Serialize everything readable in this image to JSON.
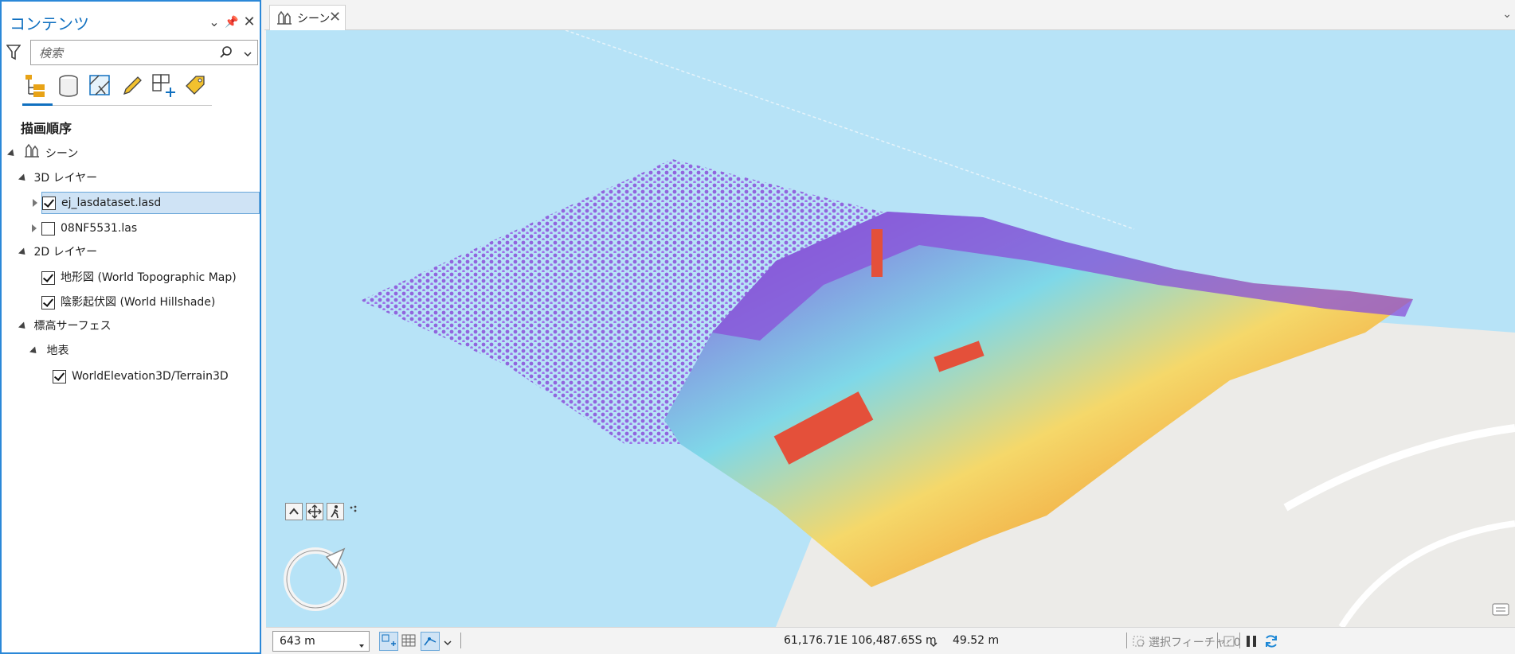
{
  "contents_pane": {
    "title": "コンテンツ",
    "search_placeholder": "検索",
    "toolbar_icons": [
      "drawing-order-icon",
      "data-source-icon",
      "selection-icon",
      "editing-icon",
      "snapping-icon",
      "labeling-icon"
    ],
    "section_title": "描画順序",
    "tree": {
      "scene": "シーン",
      "group_3d": "3D レイヤー",
      "layer_lasd": "ej_lasdataset.lasd",
      "layer_las": "08NF5531.las",
      "group_2d": "2D レイヤー",
      "layer_topo": "地形図 (World Topographic Map)",
      "layer_hillshade": "陰影起伏図 (World Hillshade)",
      "group_elev": "標高サーフェス",
      "ground": "地表",
      "layer_terrain": "WorldElevation3D/Terrain3D"
    },
    "checked": {
      "layer_lasd": true,
      "layer_las": false,
      "layer_topo": true,
      "layer_hillshade": true,
      "layer_terrain": true
    }
  },
  "view_tab": {
    "label": "シーン"
  },
  "statusbar": {
    "scale": "643 m",
    "coordinates": "61,176.71E 106,487.65S m",
    "elevation": "49.52 m",
    "selected_features": "選択フィーチャ: 0"
  },
  "colors": {
    "accent": "#1070c0",
    "water": "#b7e3f7",
    "land": "#ecebe8",
    "pc_low": "#8a4fd8",
    "pc_mid": "#f5c53a",
    "pc_high": "#e4503a"
  }
}
